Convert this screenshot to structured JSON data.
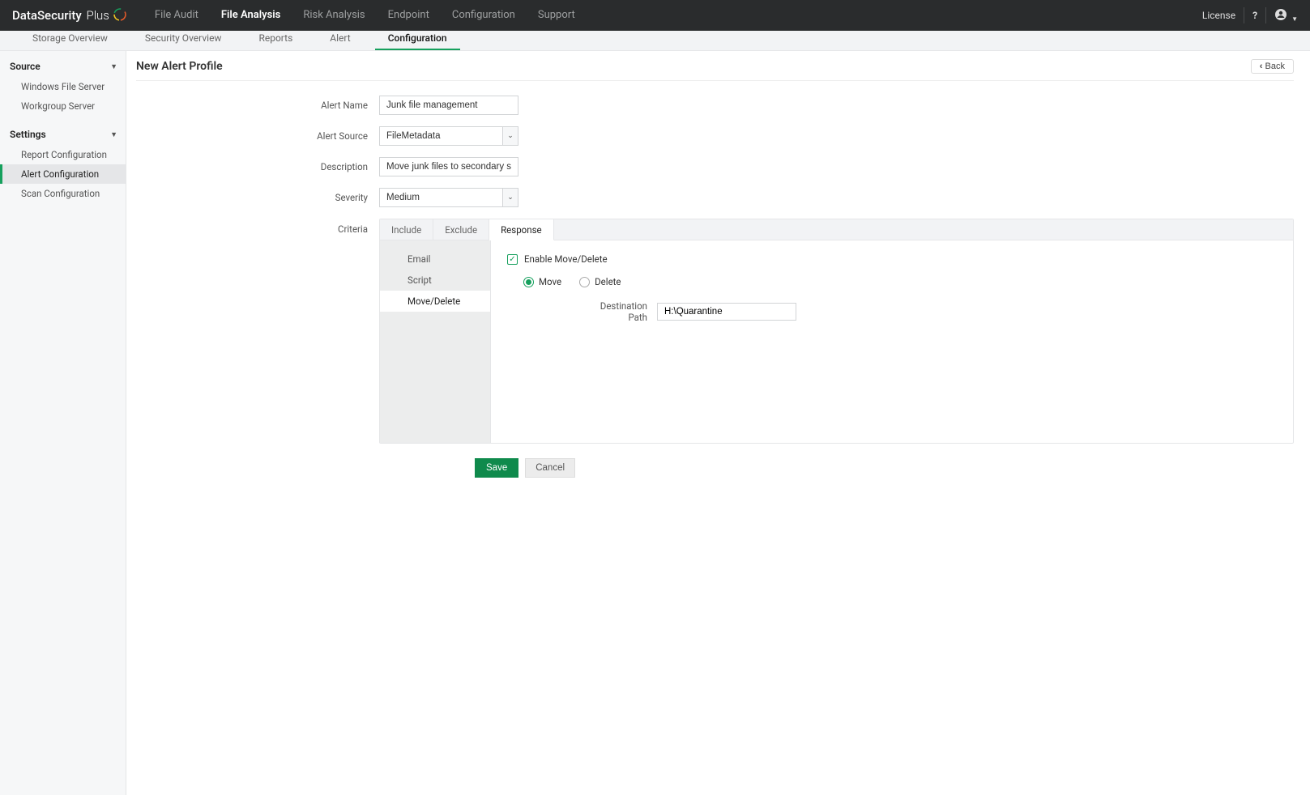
{
  "brand": {
    "name": "DataSecurity",
    "suffix": "Plus"
  },
  "topnav": {
    "items": [
      "File Audit",
      "File Analysis",
      "Risk Analysis",
      "Endpoint",
      "Configuration",
      "Support"
    ],
    "active_index": 1
  },
  "top_right": {
    "license": "License"
  },
  "subnav": {
    "items": [
      "Storage Overview",
      "Security Overview",
      "Reports",
      "Alert",
      "Configuration"
    ],
    "active_index": 4
  },
  "sidebar": {
    "sections": [
      {
        "title": "Source",
        "items": [
          "Windows File Server",
          "Workgroup Server"
        ],
        "active_index": -1
      },
      {
        "title": "Settings",
        "items": [
          "Report Configuration",
          "Alert Configuration",
          "Scan Configuration"
        ],
        "active_index": 1
      }
    ]
  },
  "page": {
    "title": "New Alert Profile",
    "back_label": "Back"
  },
  "form": {
    "alert_name": {
      "label": "Alert Name",
      "value": "Junk file management"
    },
    "alert_source": {
      "label": "Alert Source",
      "value": "FileMetadata"
    },
    "description": {
      "label": "Description",
      "value": "Move junk files to secondary storage."
    },
    "severity": {
      "label": "Severity",
      "value": "Medium"
    },
    "criteria": {
      "label": "Criteria",
      "tabs": [
        "Include",
        "Exclude",
        "Response"
      ],
      "active_tab": 2,
      "response_side": {
        "items": [
          "Email",
          "Script",
          "Move/Delete"
        ],
        "active_index": 2
      },
      "response": {
        "enable_label": "Enable Move/Delete",
        "enable_checked": true,
        "mode_options": [
          "Move",
          "Delete"
        ],
        "mode_selected": 0,
        "destination": {
          "label": "Destination Path",
          "value": "H:\\Quarantine"
        }
      }
    }
  },
  "buttons": {
    "save": "Save",
    "cancel": "Cancel"
  }
}
